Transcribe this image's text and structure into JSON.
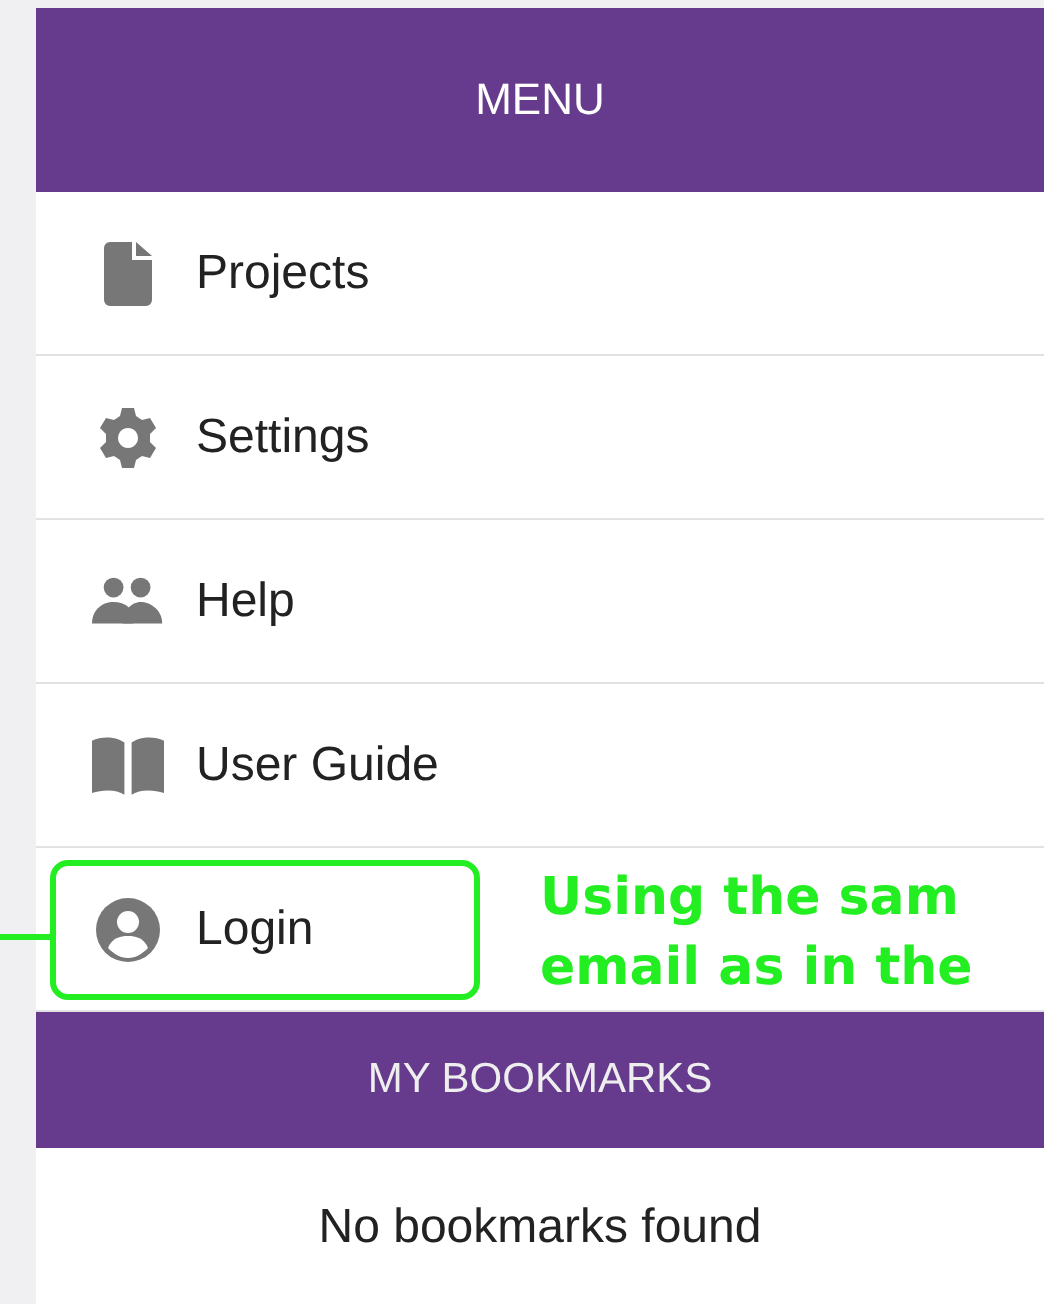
{
  "header": {
    "title": "MENU"
  },
  "menu_items": [
    {
      "label": "Projects",
      "kind": "file",
      "highlighted": false
    },
    {
      "label": "Settings",
      "kind": "gear",
      "highlighted": false
    },
    {
      "label": "Help",
      "kind": "people",
      "highlighted": false
    },
    {
      "label": "User Guide",
      "kind": "book",
      "highlighted": false
    },
    {
      "label": "Login",
      "kind": "user",
      "highlighted": true
    }
  ],
  "annotation": {
    "lines": [
      "Using the sam",
      "email as in the"
    ]
  },
  "bookmarks": {
    "title": "MY BOOKMARKS",
    "empty_text": "No bookmarks found"
  }
}
